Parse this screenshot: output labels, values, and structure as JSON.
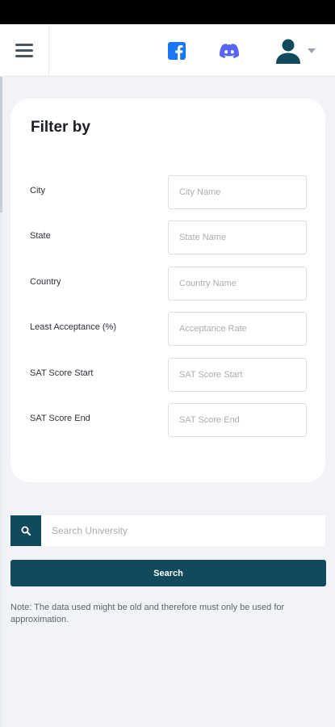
{
  "nav": {
    "menu_icon": "hamburger-menu-icon",
    "facebook_icon": "facebook-icon",
    "discord_icon": "discord-icon",
    "profile_icon": "user-avatar-icon",
    "dropdown_icon": "caret-down-icon"
  },
  "filter": {
    "title": "Filter by",
    "fields": [
      {
        "label": "City",
        "placeholder": "City Name",
        "value": ""
      },
      {
        "label": "State",
        "placeholder": "State Name",
        "value": ""
      },
      {
        "label": "Country",
        "placeholder": "Country Name",
        "value": ""
      },
      {
        "label": "Least Acceptance (%)",
        "placeholder": "Acceptance Rate",
        "value": ""
      },
      {
        "label": "SAT Score Start",
        "placeholder": "SAT Score Start",
        "value": ""
      },
      {
        "label": "SAT Score End",
        "placeholder": "SAT Score End",
        "value": ""
      }
    ]
  },
  "search": {
    "placeholder": "Search University",
    "value": "",
    "icon": "search-icon",
    "button_label": "Search"
  },
  "note": "Note: The data used might be old and therefore must only be used for approximation.",
  "colors": {
    "primary": "#114a5c",
    "facebook": "#1877f2",
    "discord": "#5865f2",
    "background": "#f1f3f7"
  }
}
